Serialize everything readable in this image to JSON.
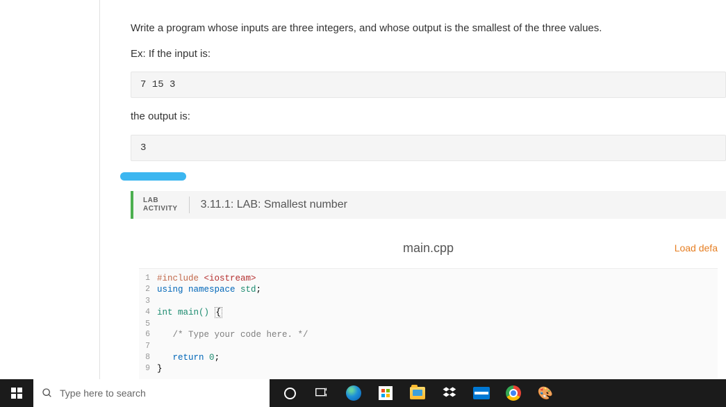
{
  "problem": {
    "description": "Write a program whose inputs are three integers, and whose output is the smallest of the three values.",
    "example_prefix": "Ex: If the input is:",
    "example_input": "7 15 3",
    "output_label": "the output is:",
    "example_output": "3"
  },
  "lab": {
    "label_line1": "LAB",
    "label_line2": "ACTIVITY",
    "title": "3.11.1: LAB: Smallest number"
  },
  "editor": {
    "filename": "main.cpp",
    "load_default": "Load defa",
    "code": {
      "l1_include": "#include",
      "l1_header": " <iostream>",
      "l2_using": "using",
      "l2_ns": " namespace",
      "l2_std": " std",
      "l2_semi": ";",
      "l4_int": "int",
      "l4_main": " main() ",
      "l4_brace": "{",
      "l6_indent": "   ",
      "l6_cmt": "/* Type your code here. */",
      "l8_indent": "   ",
      "l8_ret": "return",
      "l8_zero_sp": " ",
      "l8_zero": "0",
      "l8_semi": ";",
      "l9_brace": "}"
    }
  },
  "taskbar": {
    "search_placeholder": "Type here to search"
  }
}
